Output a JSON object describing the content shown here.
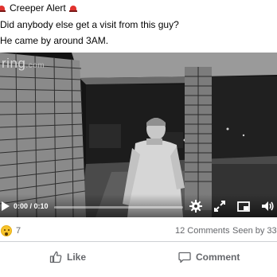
{
  "post": {
    "title": "Creeper Alert",
    "line2": "Did anybody else get a visit from this guy?",
    "line3": "He came by around 3AM."
  },
  "video": {
    "brand": "ring",
    "brand_suffix": ".com",
    "time": "0:00 / 0:10",
    "progress": 0.0,
    "icons": [
      "play-icon",
      "settings-icon",
      "fullscreen-icon",
      "picture-in-picture-icon",
      "volume-icon"
    ]
  },
  "reactions": {
    "emoji": "wow-emoji",
    "count": "7",
    "comments": "12 Comments",
    "seen": "Seen by 33"
  },
  "actions": {
    "like": "Like",
    "comment": "Comment"
  },
  "colors": {
    "meta_text": "#65676b",
    "divider": "#ced0d4"
  }
}
